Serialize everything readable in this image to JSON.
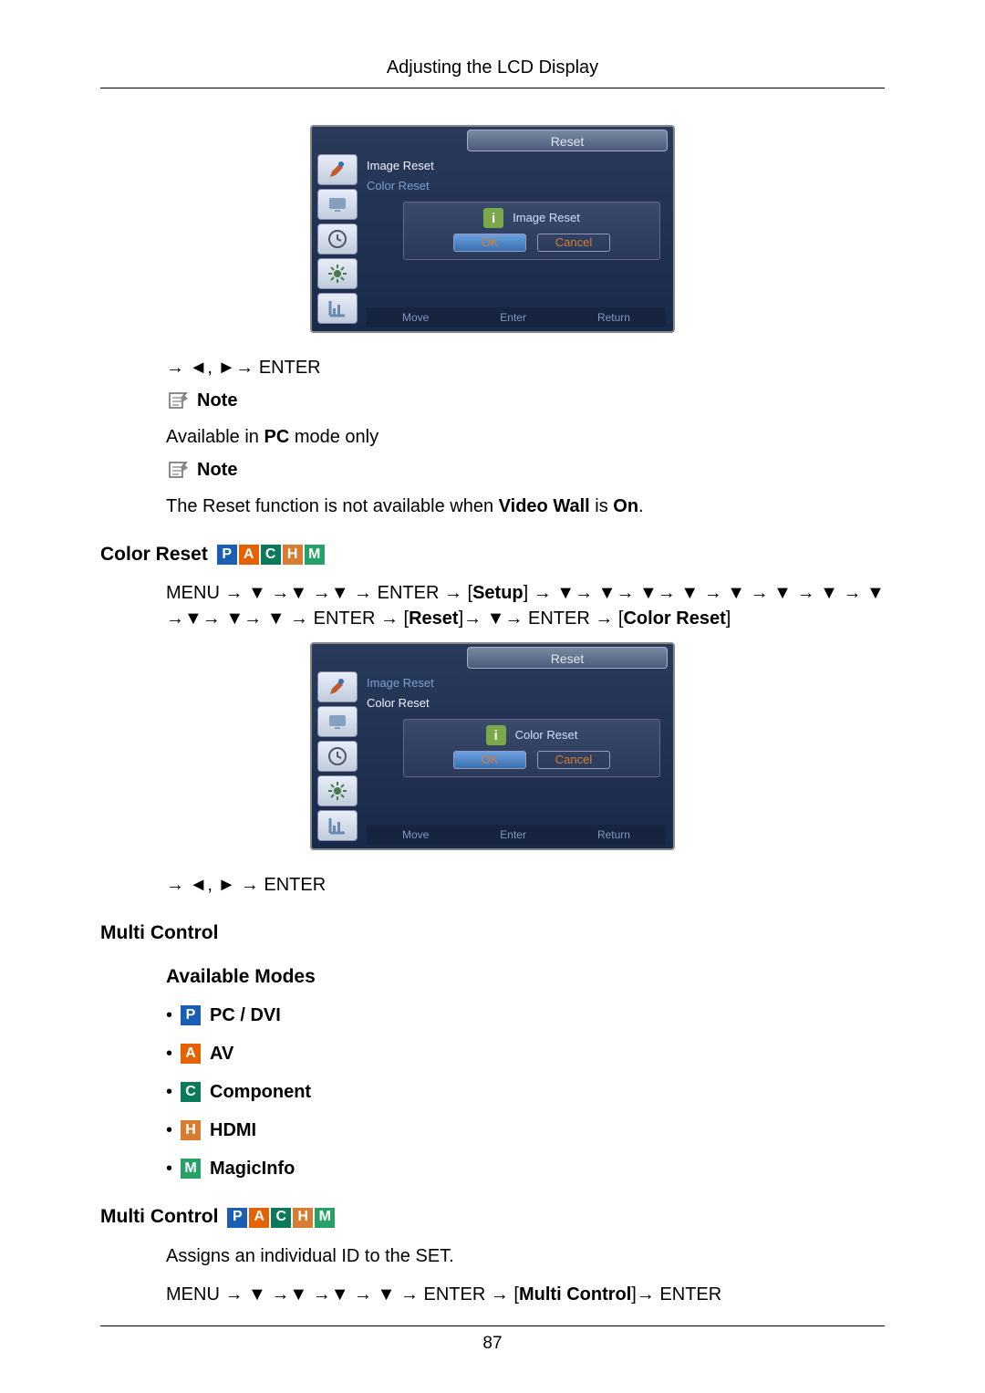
{
  "header": {
    "title": "Adjusting the LCD Display"
  },
  "osd1": {
    "tab": "Reset",
    "menu": {
      "item1": "Image Reset",
      "item2": "Color Reset"
    },
    "dialog": {
      "title": "Image Reset",
      "ok": "OK",
      "cancel": "Cancel"
    },
    "footer": {
      "move": "Move",
      "enter": "Enter",
      "return": "Return"
    }
  },
  "nav1": "→ ◄, ►→ ENTER",
  "note_label": "Note",
  "note1_text": "Available in PC mode only",
  "note2_text_a": "The Reset function is not available when ",
  "note2_text_b": "Video Wall",
  "note2_text_c": " is ",
  "note2_text_d": "On",
  "note2_text_e": ".",
  "section_color_reset": "Color Reset",
  "color_reset_path_a": "MENU → ▼ →▼ →▼ → ENTER → [",
  "color_reset_path_b": "Setup",
  "color_reset_path_c": "] → ▼→ ▼→ ▼→ ▼ → ▼ → ▼ → ▼ → ▼ →▼→ ▼→ ▼ → ENTER → [",
  "color_reset_path_d": "Reset",
  "color_reset_path_e": "]→ ▼→ ENTER → [",
  "color_reset_path_f": "Color Reset",
  "color_reset_path_g": "]",
  "osd2": {
    "tab": "Reset",
    "menu": {
      "item1": "Image Reset",
      "item2": "Color Reset"
    },
    "dialog": {
      "title": "Color Reset",
      "ok": "OK",
      "cancel": "Cancel"
    },
    "footer": {
      "move": "Move",
      "enter": "Enter",
      "return": "Return"
    }
  },
  "nav2": "→ ◄, ► → ENTER",
  "section_multi_control": "Multi Control",
  "subheading_modes": "Available Modes",
  "modes": {
    "p": "PC / DVI",
    "a": "AV",
    "c": "Component",
    "h": "HDMI",
    "m": "MagicInfo"
  },
  "section_multi_control2": "Multi Control",
  "multi_control_desc": "Assigns an individual ID to the SET.",
  "multi_control_path_a": "MENU → ▼ →▼ →▼ → ▼ → ENTER → [",
  "multi_control_path_b": "Multi Control",
  "multi_control_path_c": "]→ ENTER",
  "page_number": "87"
}
